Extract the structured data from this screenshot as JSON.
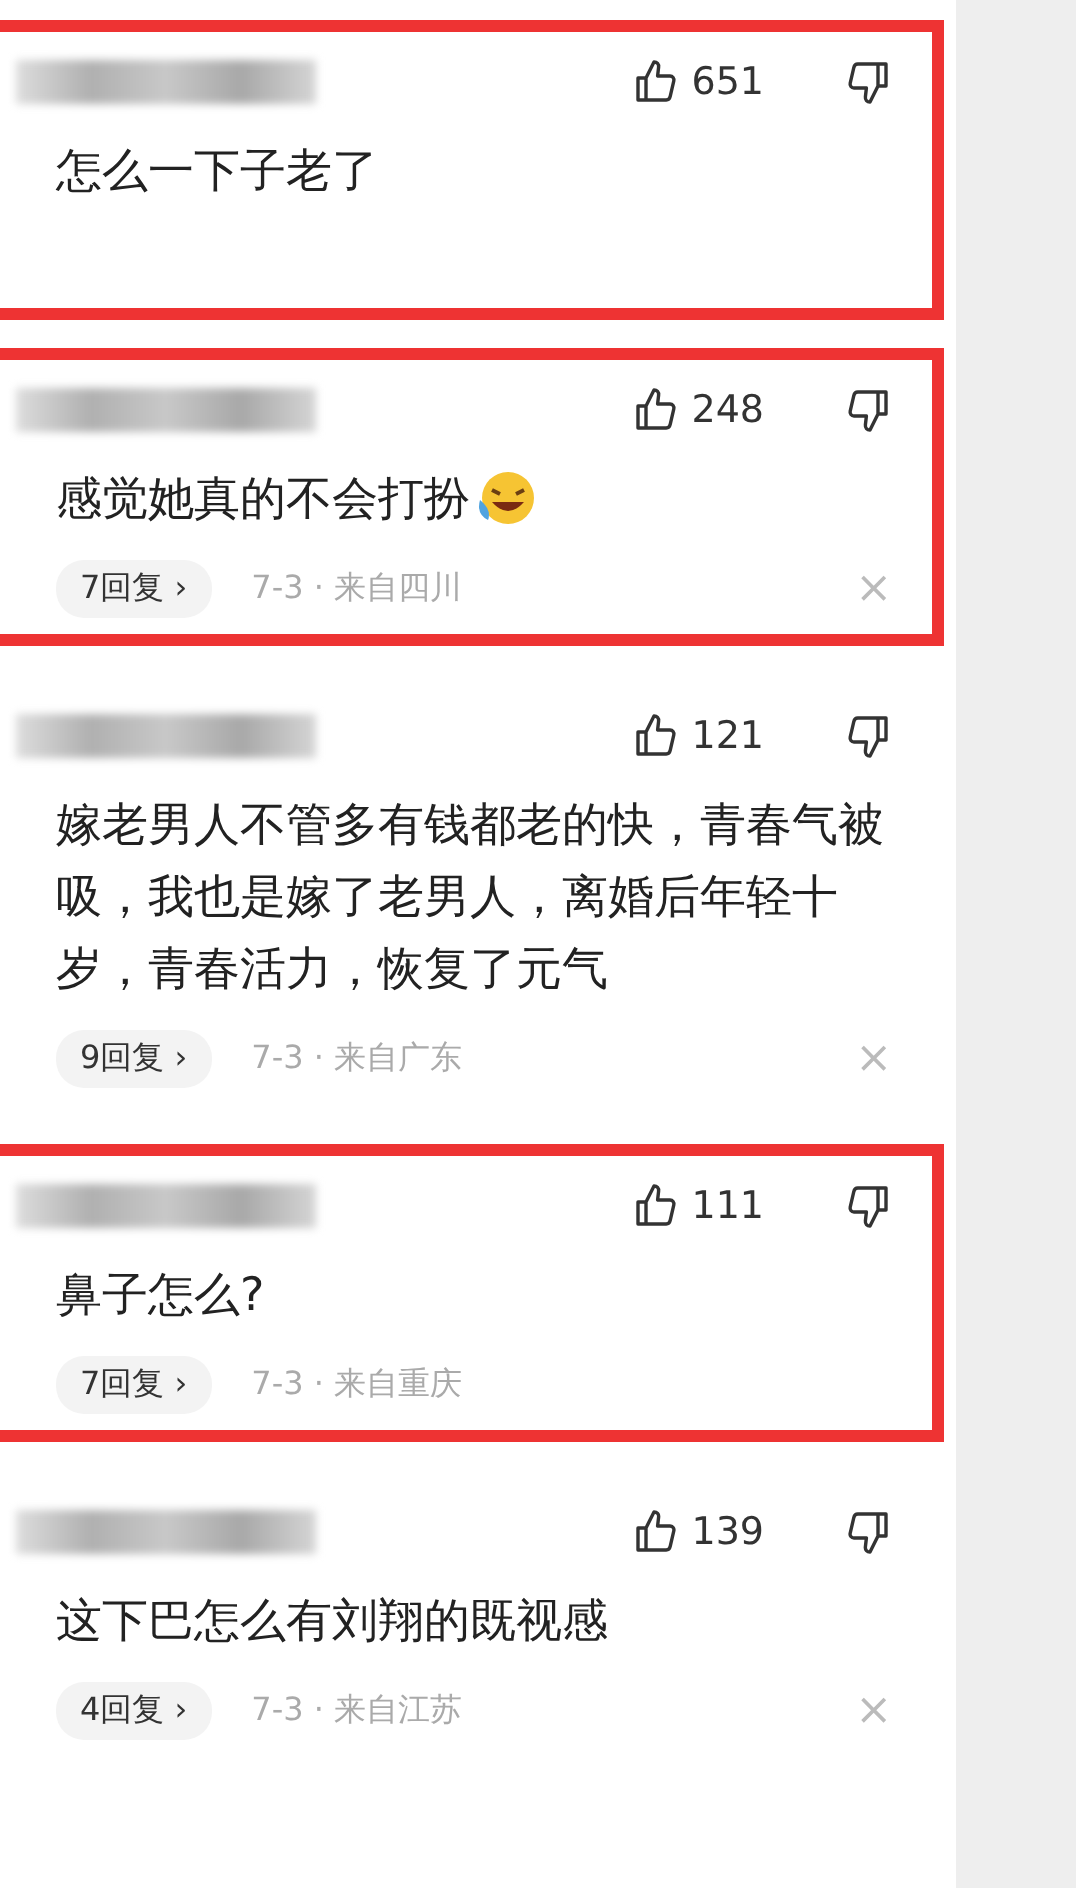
{
  "comments": [
    {
      "likes": "651",
      "text": "怎么一下子老了",
      "emoji": false,
      "highlighted": true
    },
    {
      "likes": "248",
      "text": "感觉她真的不会打扮",
      "emoji": true,
      "highlighted": true,
      "replies": "7回复",
      "reply_arrow": "›",
      "meta": "7-3 · 来自四川",
      "close": "×"
    },
    {
      "likes": "121",
      "text": "嫁老男人不管多有钱都老的快，青春气被吸，我也是嫁了老男人，离婚后年轻十岁，青春活力，恢复了元气",
      "emoji": false,
      "highlighted": false,
      "replies": "9回复",
      "reply_arrow": "›",
      "meta": "7-3 · 来自广东",
      "close": "×"
    },
    {
      "likes": "111",
      "text": "鼻子怎么?",
      "emoji": false,
      "highlighted": true,
      "replies": "7回复",
      "reply_arrow": "›",
      "meta": "7-3 · 来自重庆"
    },
    {
      "likes": "139",
      "text": "这下巴怎么有刘翔的既视感",
      "emoji": false,
      "highlighted": false,
      "replies": "4回复",
      "reply_arrow": "›",
      "meta": "7-3 · 来自江苏",
      "close": "×"
    }
  ]
}
